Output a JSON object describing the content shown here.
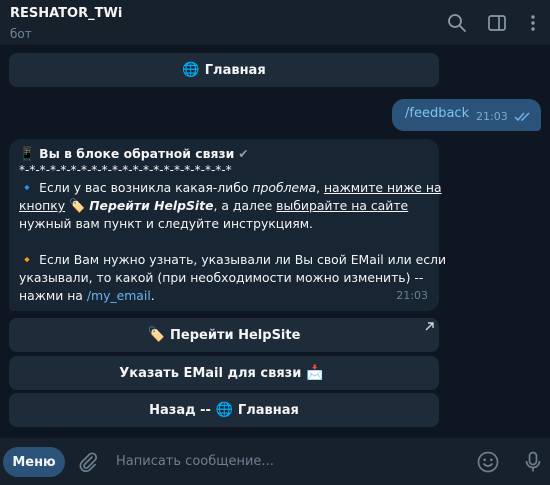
{
  "header": {
    "title": "RESHATOR_TWi",
    "subtitle": "бот"
  },
  "chat": {
    "top_button": {
      "emoji": "🌐",
      "label": "Главная"
    },
    "outgoing": {
      "text": "/feedback",
      "time": "21:03"
    },
    "incoming": {
      "line1": {
        "emoji": "📱",
        "text": "Вы в блоке обратной связи",
        "check": "✔"
      },
      "line2": "*-*-*-*-*-*-*-*-*-*-*-*-*-*-*-*-*-*-*-*-*",
      "p1_emoji": "🔹",
      "p1_a": "Если у вас возникла какая-либо ",
      "p1_b": "проблема",
      "p1_c": ", ",
      "p1_d": "нажмите ниже на",
      "p1_e": "кнопку",
      "p1_emoji2": "🏷️",
      "p1_f": "Перейти HelpSite",
      "p1_g": ", а далее ",
      "p1_h": "выбирайте на сайте",
      "p1_i": "нужный вам пункт и следуйте инструкциям.",
      "p2_emoji": "🔸",
      "p2_a": "Если Вам нужно узнать, указывали ли Вы свой EMail или если",
      "p2_b": "указывали, то какой (при необходимости можно изменить) --",
      "p2_c": "нажми на ",
      "p2_link": "/my_email",
      "p2_d": ".",
      "time": "21:03"
    },
    "buttons": [
      {
        "emoji": "🏷️",
        "label": "Перейти HelpSite",
        "has_link_arrow": true
      },
      {
        "emoji": "📩",
        "label": "Указать EMail для связи",
        "emoji_after": true
      },
      {
        "emoji": "🌐",
        "label": "Назад -- ",
        "label_after": "Главная"
      }
    ]
  },
  "input": {
    "menu_label": "Меню",
    "placeholder": "Написать сообщение..."
  },
  "colors": {
    "background": "#0e1621",
    "panel": "#17212b",
    "bubble_out": "#2b5278",
    "bubble_in": "#182533",
    "link": "#6ab3f3"
  }
}
